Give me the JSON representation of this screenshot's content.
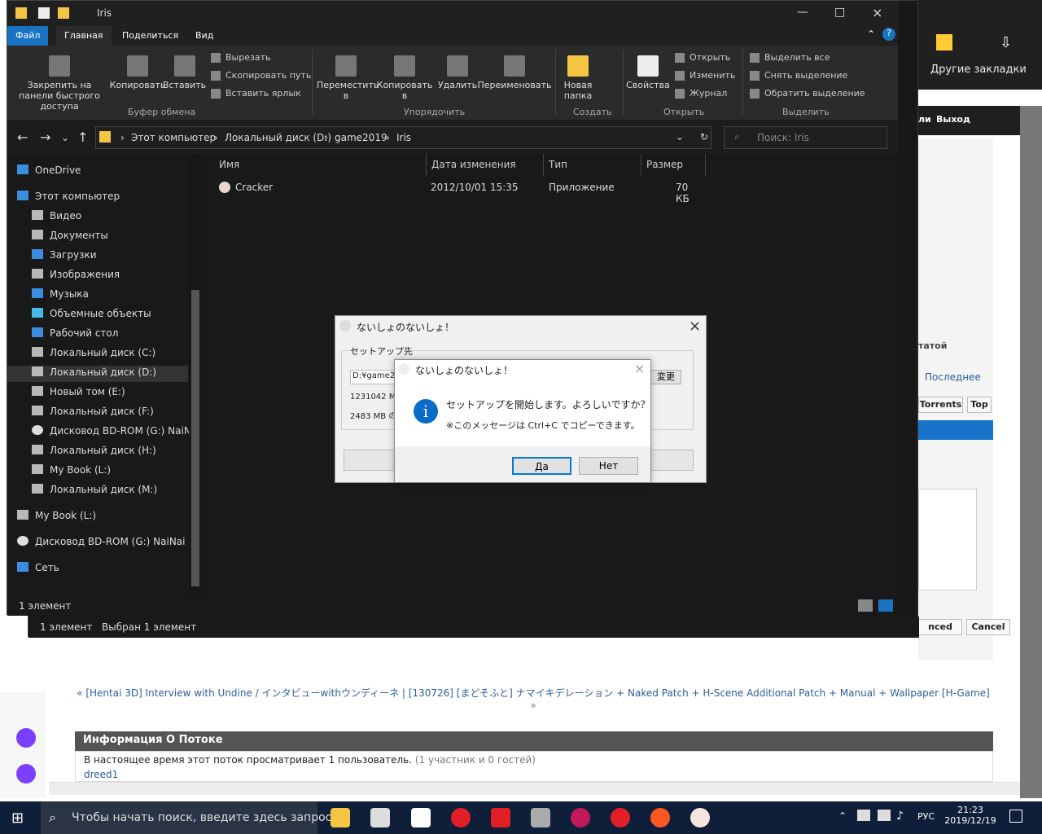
{
  "browser": {
    "top_bookmarks_label": "Другие закладки",
    "logout_label": "Выход",
    "partial_label_1": "ли",
    "partial_label_2": "татой",
    "last_label": "Последнее",
    "torrents_label": "Torrents",
    "top_label": "Top",
    "advanced_label": "nced",
    "cancel_label": "Cancel",
    "prev_thread": "« [Hentai 3D] Interview with Undine / インタビューwithウンディーネ | [130726] [まどそふと] ナマイキデレーション + Naked Patch + H-Scene Additional Patch + Manual + Wallpaper [H-Game]",
    "prev_thread_end": "»",
    "info_title": "Информация О Потоке",
    "info_text": "В настоящее время этот поток просматривает 1 пользователь.",
    "info_gray": "(1 участник и 0 гостей)",
    "user": "dreed1"
  },
  "explorer": {
    "title": "Iris",
    "tabs": [
      "Файл",
      "Главная",
      "Поделиться",
      "Вид"
    ],
    "ribbon": {
      "pin": "Закрепить на панели быстрого доступа",
      "copy": "Копировать",
      "paste": "Вставить",
      "cut": "Вырезать",
      "copy_path": "Скопировать путь",
      "paste_shortcut": "Вставить ярлык",
      "clipboard_group": "Буфер обмена",
      "move": "Переместить в",
      "copy_to": "Копировать в",
      "delete": "Удалить",
      "rename": "Переименовать",
      "organize_group": "Упорядочить",
      "new_folder": "Новая папка",
      "create_group": "Создать",
      "properties": "Свойства",
      "open": "Открыть",
      "edit": "Изменить",
      "history": "Журнал",
      "open_group": "Открыть",
      "select_all": "Выделить все",
      "select_none": "Снять выделение",
      "invert_select": "Обратить выделение",
      "select_group": "Выделить"
    },
    "path": [
      "Этот компьютер",
      "Локальный диск (D:)",
      "game2019",
      "Iris"
    ],
    "search_placeholder": "Поиск: Iris",
    "nav": [
      "OneDrive",
      "Этот компьютер",
      "Видео",
      "Документы",
      "Загрузки",
      "Изображения",
      "Музыка",
      "Объемные объекты",
      "Рабочий стол",
      "Локальный диск (C:)",
      "Локальный диск (D:)",
      "Новый том (E:)",
      "Локальный диск (F:)",
      "Дисковод BD-ROM (G:) NaiNai",
      "Локальный диск (H:)",
      "My Book (L:)",
      "Локальный диск (M:)",
      "My Book (L:)",
      "Дисковод BD-ROM (G:) NaiNai",
      "Сеть"
    ],
    "columns": [
      "Имя",
      "Дата изменения",
      "Тип",
      "Размер"
    ],
    "file": {
      "name": "Cracker",
      "date": "2012/10/01 15:35",
      "type": "Приложение",
      "size": "70 КБ"
    },
    "status_primary": "1 элемент",
    "status_secondary": "Выбран 1 элемент"
  },
  "dialog_back": {
    "title": "ないしょのないしょ！",
    "group": "セットアップ先",
    "path": "D:¥game20",
    "size1": "1231042 MB",
    "size2": "2483 MB の",
    "change": "変更"
  },
  "dialog": {
    "title": "ないしょのないしょ！",
    "message": "セットアップを開始します。よろしいですか？",
    "note": "※このメッセージは Ctrl+C でコピーできます。",
    "yes": "Да",
    "no": "Нет"
  },
  "taskbar": {
    "search_placeholder": "Чтобы начать поиск, введите здесь запрос",
    "lang": "РУС",
    "time": "21:23",
    "date": "2019/12/19"
  },
  "colors": {
    "accent": "#1a73c2",
    "dark": "#191919",
    "taskbar": "#0f1f3a"
  }
}
